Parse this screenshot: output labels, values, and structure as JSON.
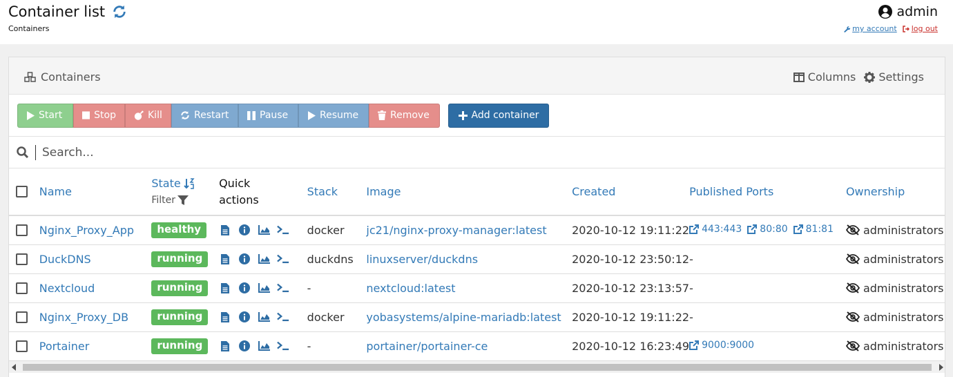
{
  "header": {
    "title": "Container list",
    "subtitle": "Containers",
    "user": "admin",
    "my_account": "my account",
    "logout": "log out"
  },
  "panel": {
    "title": "Containers",
    "columns_label": "Columns",
    "settings_label": "Settings"
  },
  "actions": {
    "start": "Start",
    "stop": "Stop",
    "kill": "Kill",
    "restart": "Restart",
    "pause": "Pause",
    "resume": "Resume",
    "remove": "Remove",
    "add": "Add container"
  },
  "search": {
    "placeholder": "Search..."
  },
  "table": {
    "headers": {
      "name": "Name",
      "state": "State",
      "filter": "Filter",
      "quick_actions_1": "Quick",
      "quick_actions_2": "actions",
      "stack": "Stack",
      "image": "Image",
      "created": "Created",
      "ports": "Published Ports",
      "ownership": "Ownership"
    },
    "rows": [
      {
        "name": "Nginx_Proxy_App",
        "state": "healthy",
        "stack": "docker",
        "image": "jc21/nginx-proxy-manager:latest",
        "created": "2020-10-12 19:11:22",
        "ports": [
          "443:443",
          "80:80",
          "81:81"
        ],
        "ownership": "administrators"
      },
      {
        "name": "DuckDNS",
        "state": "running",
        "stack": "duckdns",
        "image": "linuxserver/duckdns",
        "created": "2020-10-12 23:50:12",
        "ports_text": "-",
        "ownership": "administrators"
      },
      {
        "name": "Nextcloud",
        "state": "running",
        "stack": "-",
        "image": "nextcloud:latest",
        "created": "2020-10-12 23:13:57",
        "ports_text": "-",
        "ownership": "administrators"
      },
      {
        "name": "Nginx_Proxy_DB",
        "state": "running",
        "stack": "docker",
        "image": "yobasystems/alpine-mariadb:latest",
        "created": "2020-10-12 19:11:22",
        "ports_text": "-",
        "ownership": "administrators"
      },
      {
        "name": "Portainer",
        "state": "running",
        "stack": "-",
        "image": "portainer/portainer-ce",
        "created": "2020-10-12 16:23:49",
        "ports": [
          "9000:9000"
        ],
        "ownership": "administrators"
      }
    ]
  },
  "colors": {
    "link": "#337ab7",
    "success": "#5cb85c",
    "primary": "#2e6da4",
    "danger": "#e58e8b"
  }
}
